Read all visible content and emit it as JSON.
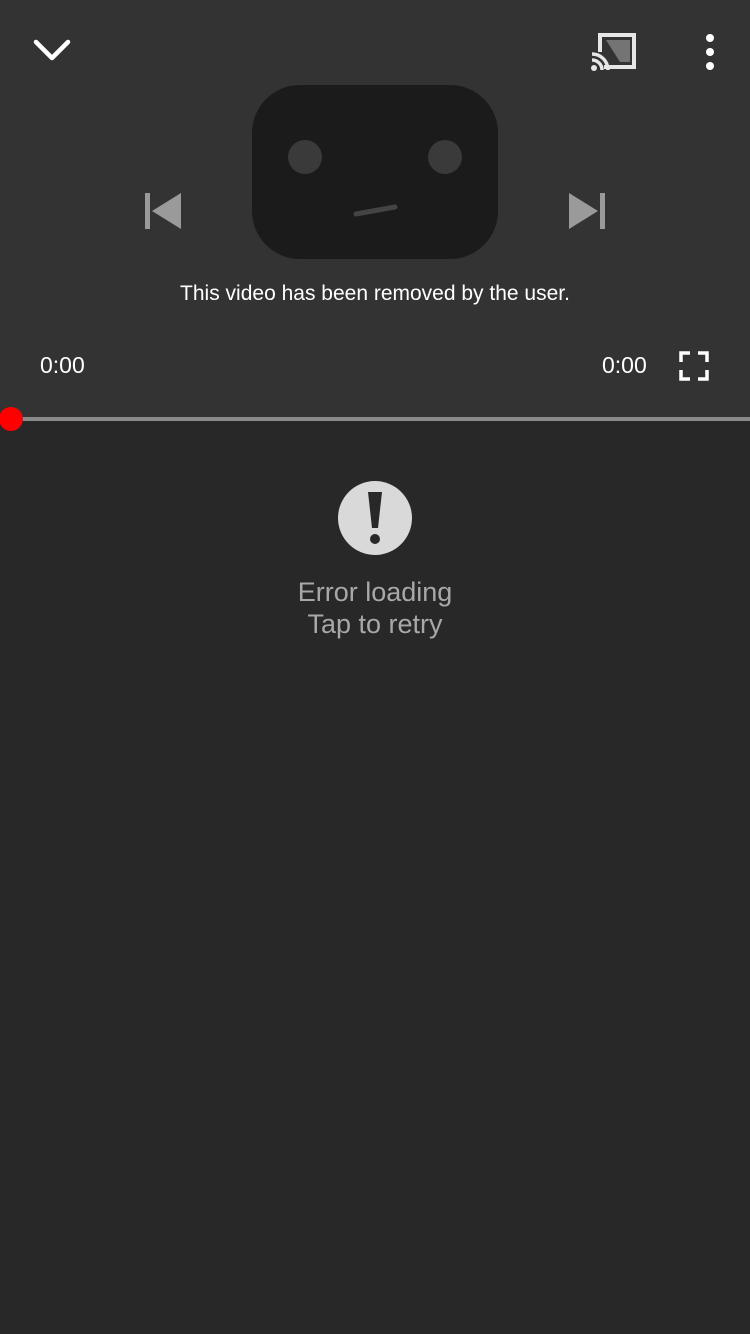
{
  "player": {
    "message": "This video has been removed by the user.",
    "current_time": "0:00",
    "total_time": "0:00",
    "progress": 0,
    "accent_color": "#ff0000",
    "icons": {
      "collapse": "chevron-down-icon",
      "cast": "cast-icon",
      "more": "more-vert-icon",
      "previous": "skip-previous-icon",
      "next": "skip-next-icon",
      "fullscreen": "fullscreen-icon",
      "placeholder": "sad-tv-icon"
    }
  },
  "error": {
    "icon": "error-exclamation-icon",
    "line1": "Error loading",
    "line2": "Tap to retry"
  }
}
